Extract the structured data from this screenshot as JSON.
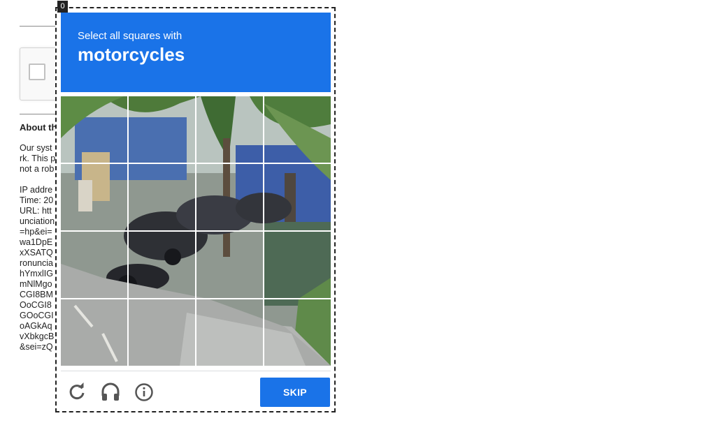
{
  "background_page": {
    "about_title": "About th",
    "text_lines": [
      "Our syst",
      "rk. This p",
      "not a rob",
      "",
      "IP addre",
      "Time: 20",
      "URL: htt",
      "unciation",
      "=hp&ei=",
      "wa1DpE",
      "xXSATQ",
      "ronuncia",
      "hYmxlIG",
      "mNlMgo",
      "CGI8BM",
      "OoCGI8",
      "GOoCGI",
      "oAGkAq",
      "vXbkgcB",
      "&sei=zQ"
    ]
  },
  "challenge": {
    "corner_badge": "0",
    "instruction": "Select all squares with",
    "keyword": "motorcycles",
    "grid": {
      "rows": 4,
      "cols": 4,
      "selected": []
    },
    "footer": {
      "reload_icon": "reload-icon",
      "audio_icon": "headphones-icon",
      "info_icon": "info-icon",
      "skip_label": "SKIP"
    },
    "colors": {
      "accent": "#1a73e8",
      "header_text": "#ffffff",
      "icon": "#555555"
    }
  }
}
